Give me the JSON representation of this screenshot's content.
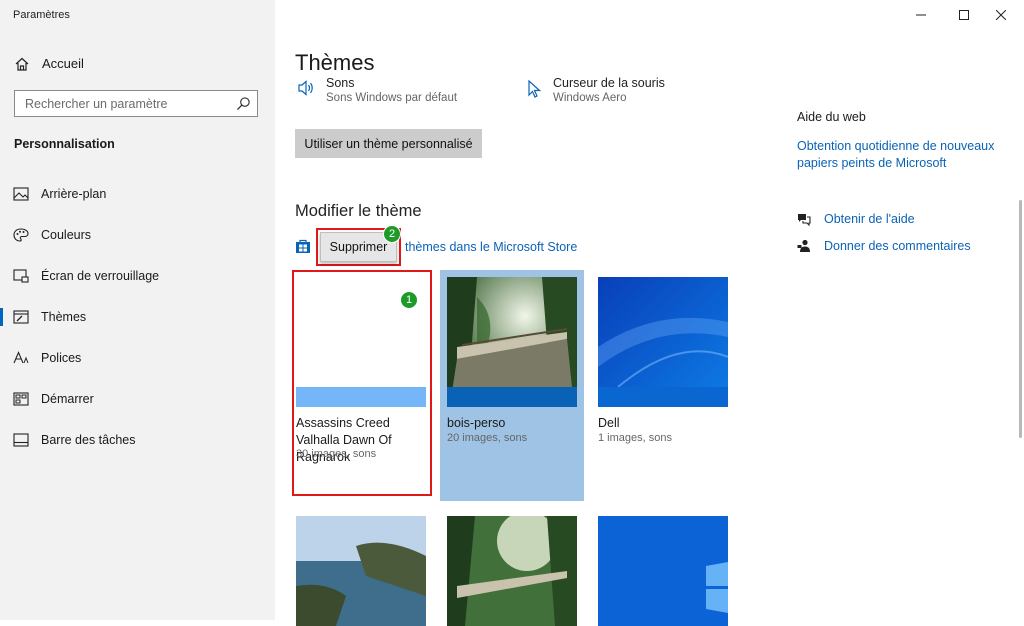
{
  "window": {
    "title": "Paramètres",
    "minimize_glyph": "—",
    "maximize_glyph": "☐",
    "close_glyph": "✕"
  },
  "sidebar": {
    "home": {
      "label": "Accueil",
      "icon": "home-icon"
    },
    "search": {
      "placeholder": "Rechercher un paramètre",
      "value": ""
    },
    "section": "Personnalisation",
    "items": [
      {
        "label": "Arrière-plan",
        "icon": "picture-icon",
        "active": false
      },
      {
        "label": "Couleurs",
        "icon": "palette-icon",
        "active": false
      },
      {
        "label": "Écran de verrouillage",
        "icon": "lockscreen-icon",
        "active": false
      },
      {
        "label": "Thèmes",
        "icon": "themes-icon",
        "active": true
      },
      {
        "label": "Polices",
        "icon": "fonts-icon",
        "active": false
      },
      {
        "label": "Démarrer",
        "icon": "start-icon",
        "active": false
      },
      {
        "label": "Barre des tâches",
        "icon": "taskbar-icon",
        "active": false
      }
    ]
  },
  "main": {
    "title": "Thèmes",
    "current": [
      {
        "title": "Sons",
        "subtitle": "Sons Windows par défaut",
        "icon": "speaker-icon"
      },
      {
        "title": "Curseur de la souris",
        "subtitle": "Windows Aero",
        "icon": "cursor-icon"
      }
    ],
    "custom_button": "Utiliser un thème personnalisé",
    "modify_title": "Modifier le thème",
    "store_link": "thèmes dans le Microsoft Store",
    "delete_button": "Supprimer",
    "badge_1": "1",
    "badge_2": "2",
    "themes": [
      {
        "name": "Assassins Creed Valhalla Dawn Of Ragnarok",
        "count": "30 images, sons",
        "accent": "#74b6f7",
        "selected_for_delete": true
      },
      {
        "name": "bois-perso",
        "count": "20 images, sons",
        "accent": "#0a62b6",
        "current": true
      },
      {
        "name": "Dell",
        "count": "1 images, sons",
        "accent": "#0a66d0"
      }
    ]
  },
  "help": {
    "title": "Aide du web",
    "link": "Obtention quotidienne de nouveaux papiers peints de Microsoft",
    "get_help": "Obtenir de l'aide",
    "feedback": "Donner des commentaires"
  },
  "colors": {
    "accent_link": "#0b63b6",
    "highlight_red": "#e01818",
    "badge_green": "#1e9a2a",
    "selected_tile_bg": "#9fc3e4"
  }
}
